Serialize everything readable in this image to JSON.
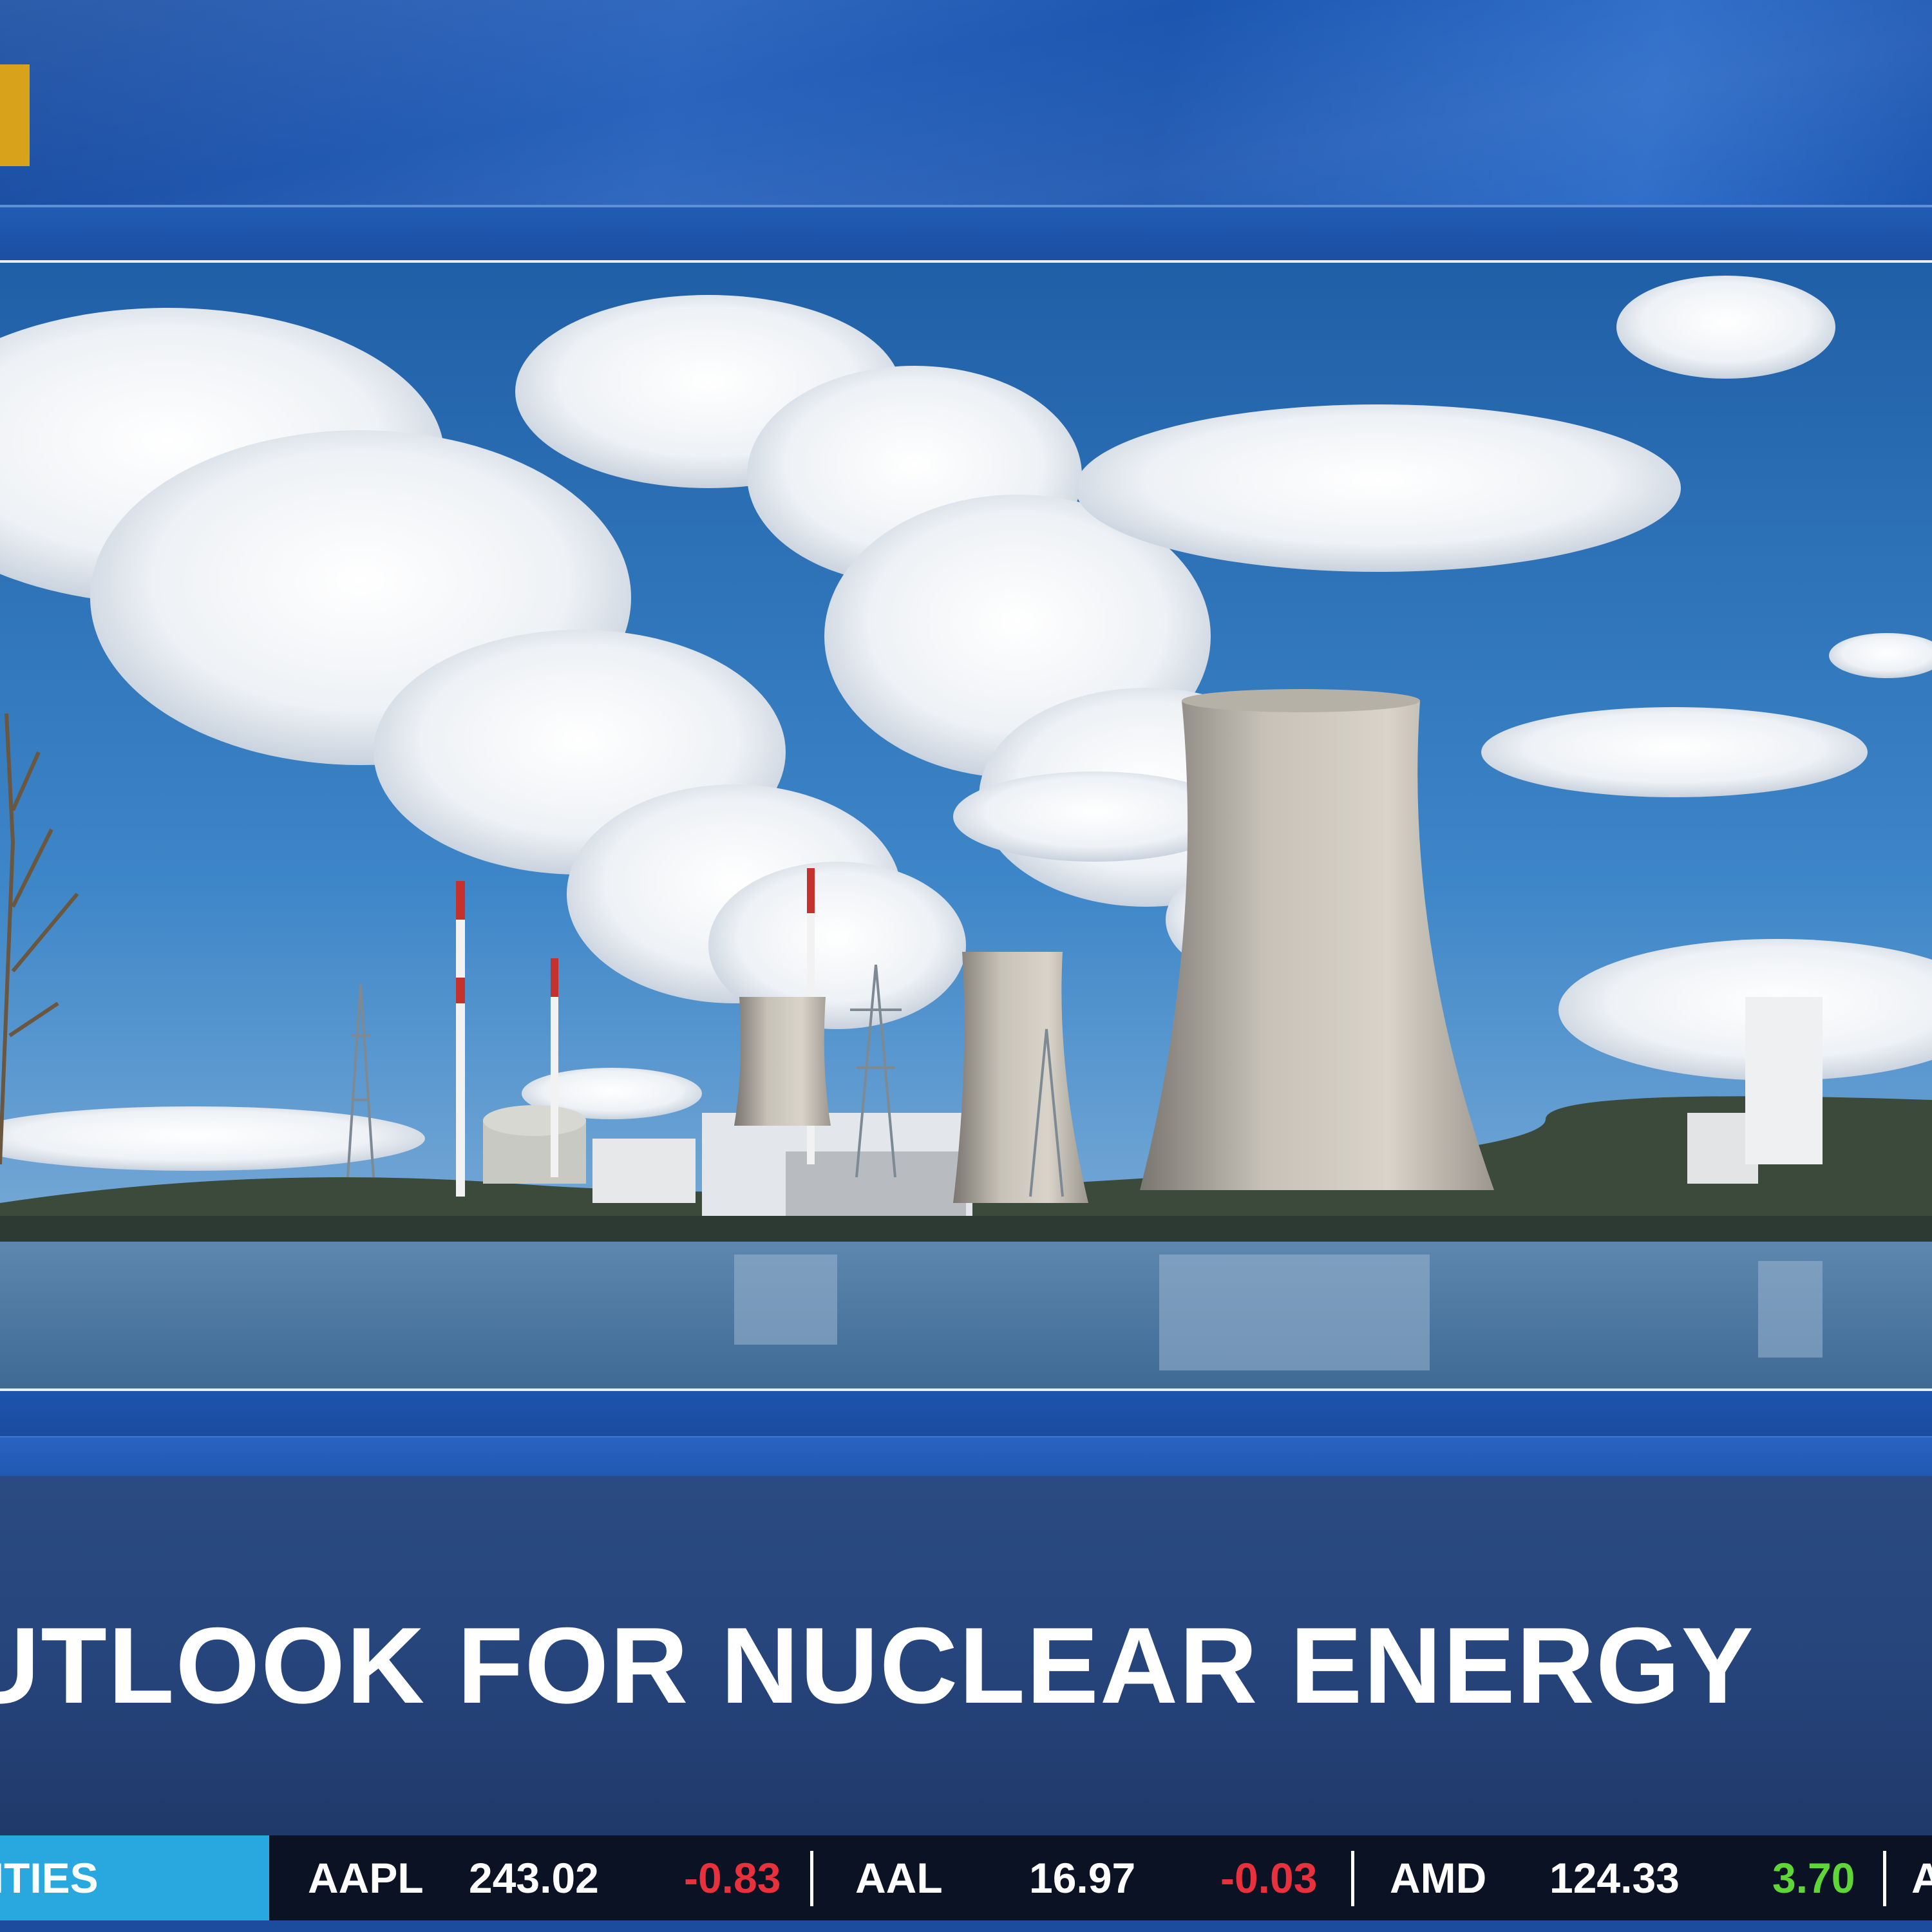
{
  "lower_third": {
    "headline": "UTLOOK FOR NUCLEAR ENERGY"
  },
  "ticker": {
    "section_label": "UITIES",
    "items": [
      {
        "symbol": "AAPL",
        "price": "243.02",
        "change": "-0.83",
        "direction": "down"
      },
      {
        "symbol": "AAL",
        "price": "16.97",
        "change": "-0.03",
        "direction": "down"
      },
      {
        "symbol": "AMD",
        "price": "124.33",
        "change": "3.70",
        "direction": "up"
      }
    ],
    "trailing_partial": "A"
  },
  "colors": {
    "accent_gold": "#d9a21b",
    "ticker_label_bg": "#29a7df",
    "negative": "#e8313d",
    "positive": "#5fd638"
  },
  "photo": {
    "subject": "nuclear-power-plant-cooling-towers-photo"
  }
}
